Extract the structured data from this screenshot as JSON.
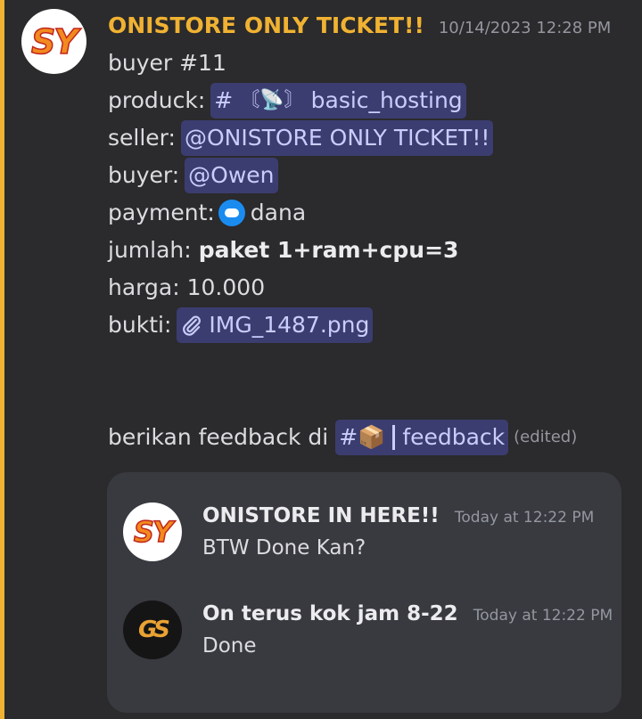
{
  "message": {
    "author": "ONISTORE ONLY TICKET!!",
    "timestamp": "10/14/2023 12:28 PM",
    "avatar_text": "SY",
    "lines": {
      "buyer_num": "buyer #11",
      "produck_label": "produck:",
      "produck_channel_hash": "#",
      "produck_channel_emoji": "〘📡〙",
      "produck_channel_name": "basic_hosting",
      "seller_label": "seller:",
      "seller_mention": "@ONISTORE ONLY TICKET!!",
      "buyer_label": "buyer:",
      "buyer_mention": "@Owen",
      "payment_label": "payment:",
      "payment_value": "dana",
      "jumlah_label": "jumlah:",
      "jumlah_value": "paket 1+ram+cpu=3",
      "harga_label": "harga:",
      "harga_value": "10.000",
      "bukti_label": "bukti:",
      "bukti_attachment": "IMG_1487.png",
      "feedback_text": "berikan feedback di",
      "feedback_channel_hash": "#📦",
      "feedback_channel_name": "feedback",
      "edited": "(edited)"
    },
    "colors": {
      "accent": "#f0b232",
      "mention_bg": "#3b3d70",
      "mention_text": "#c9cdfb"
    }
  },
  "replies": [
    {
      "author": "ONISTORE IN HERE!!",
      "time": "Today at 12:22 PM",
      "text": "BTW Done Kan?",
      "avatar_text": "SY"
    },
    {
      "author": "On terus kok jam 8-22",
      "time": "Today at 12:22 PM",
      "text": "Done",
      "avatar_text": "GS"
    }
  ],
  "icons": {
    "payment": "dana-icon",
    "attachment": "paperclip-icon"
  }
}
